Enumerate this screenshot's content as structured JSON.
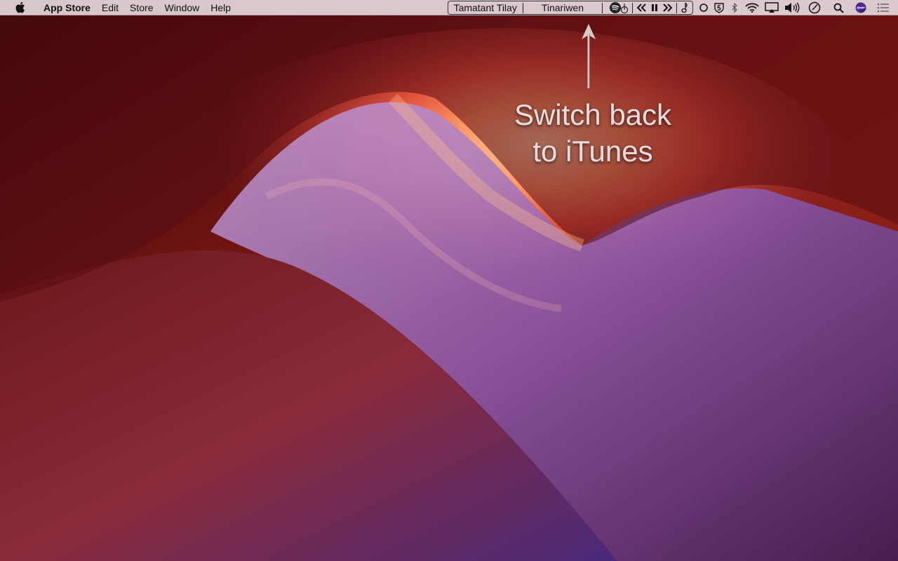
{
  "menubar": {
    "app_name": "App Store",
    "menus": [
      "Edit",
      "Store",
      "Window",
      "Help"
    ],
    "now_playing": {
      "track": "Tamatant Tilay",
      "artist": "Tinariwen"
    },
    "tray_icons": [
      "spotify-icon",
      "previous-track-icon",
      "pause-icon",
      "next-track-icon",
      "music-note-icon",
      "circle-icon",
      "shield-5-icon",
      "bluetooth-icon",
      "wifi-icon",
      "airplay-icon",
      "volume-icon",
      "clock-icon",
      "search-icon",
      "siri-icon",
      "notification-center-icon"
    ]
  },
  "annotation": {
    "line1": "Switch back",
    "line2": "to iTunes"
  },
  "colors": {
    "menubar_bg": "#ece2e8",
    "annotation_text": "#eadcdc"
  }
}
